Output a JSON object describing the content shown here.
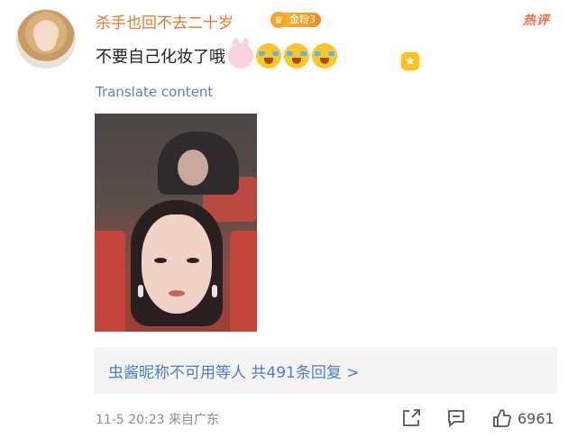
{
  "user": {
    "name": "杀手也回不去二十岁",
    "fan_badge_label": "金粉3",
    "fan_badge_icon": "crown-icon",
    "avatar_icon": "user-avatar"
  },
  "hot_label": "热评",
  "comment": {
    "text": "不要自己化妆了哦",
    "emojis": [
      "bunny-emoji",
      "crying-emoji",
      "crying-emoji",
      "crying-emoji"
    ],
    "extra_badge_icon": "sparkle-star-icon"
  },
  "translate_label": "Translate content",
  "photo": {
    "subject": "woman-portrait-photo"
  },
  "replies": {
    "text": "虫酱昵称不可用等人  共491条回复 >"
  },
  "meta": {
    "timestamp": "11-5 20:23",
    "location": "来自广东"
  },
  "actions": {
    "share_icon": "share-icon",
    "comment_icon": "comment-icon",
    "like_icon": "thumbs-up-icon",
    "like_count": "6961"
  },
  "colors": {
    "username": "#e1772b",
    "link": "#5b84b6",
    "reply_link": "#4e7fbf",
    "hot": "#ff6b3d",
    "badge": "#f5a623",
    "meta": "#8c8c8c"
  }
}
